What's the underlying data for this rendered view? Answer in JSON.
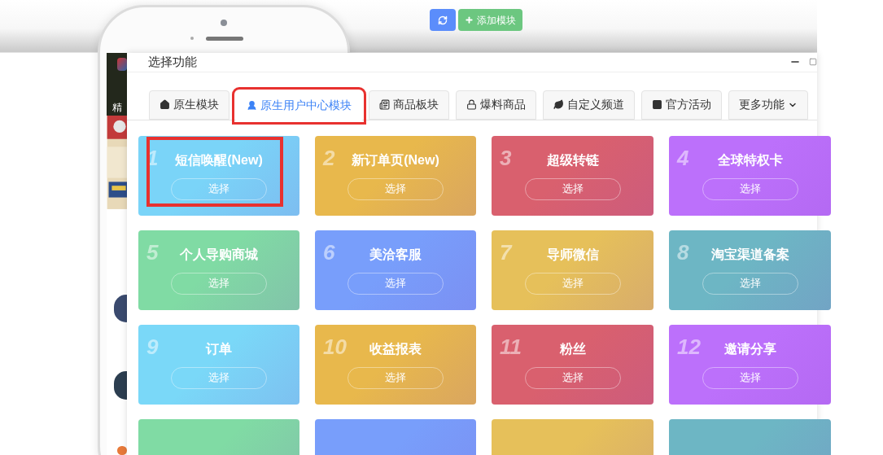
{
  "toolbar": {
    "add_button": "添加模块"
  },
  "phone": {
    "screen_label": "精"
  },
  "dialog": {
    "title": "选择功能",
    "tabs": [
      {
        "label": "原生模块",
        "kind": "tab",
        "selected": false,
        "highlighted": false
      },
      {
        "label": "原生用户中心模块",
        "kind": "tab",
        "selected": true,
        "highlighted": true
      },
      {
        "label": "商品板块",
        "kind": "tab",
        "selected": false,
        "highlighted": false
      },
      {
        "label": "爆料商品",
        "kind": "tab",
        "selected": false,
        "highlighted": false
      },
      {
        "label": "自定义频道",
        "kind": "tab",
        "selected": false,
        "highlighted": false
      },
      {
        "label": "官方活动",
        "kind": "tab",
        "selected": false,
        "highlighted": false
      },
      {
        "label": "更多功能",
        "kind": "dropdown",
        "selected": false,
        "highlighted": false
      }
    ],
    "cards": [
      {
        "number": "1",
        "title": "短信唤醒(New)",
        "button": "选择",
        "color": "#7ad4f8",
        "highlighted": true
      },
      {
        "number": "2",
        "title": "新订单页(New)",
        "button": "选择",
        "color": "#e8b84c",
        "highlighted": false
      },
      {
        "number": "3",
        "title": "超级转链",
        "button": "选择",
        "color": "#d9606e",
        "highlighted": false
      },
      {
        "number": "4",
        "title": "全球特权卡",
        "button": "选择",
        "color": "#bc70fb",
        "highlighted": false
      },
      {
        "number": "5",
        "title": "个人导购商城",
        "button": "选择",
        "color": "#80dba4",
        "highlighted": false
      },
      {
        "number": "6",
        "title": "美洽客服",
        "button": "选择",
        "color": "#789efb",
        "highlighted": false
      },
      {
        "number": "7",
        "title": "导师微信",
        "button": "选择",
        "color": "#e6c05a",
        "highlighted": false
      },
      {
        "number": "8",
        "title": "淘宝渠道备案",
        "button": "选择",
        "color": "#6db6c4",
        "highlighted": false
      },
      {
        "number": "9",
        "title": "订单",
        "button": "选择",
        "color": "#7ad8f8",
        "highlighted": false
      },
      {
        "number": "10",
        "title": "收益报表",
        "button": "选择",
        "color": "#e8b84c",
        "highlighted": false
      },
      {
        "number": "11",
        "title": "粉丝",
        "button": "选择",
        "color": "#d9606e",
        "highlighted": false
      },
      {
        "number": "12",
        "title": "邀请分享",
        "button": "选择",
        "color": "#bc70fb",
        "highlighted": false
      },
      {
        "color": "#80dba4",
        "highlighted": false
      },
      {
        "color": "#789efb",
        "highlighted": false
      },
      {
        "color": "#e6c05a",
        "highlighted": false
      },
      {
        "color": "#6db6c4",
        "highlighted": false
      }
    ]
  }
}
